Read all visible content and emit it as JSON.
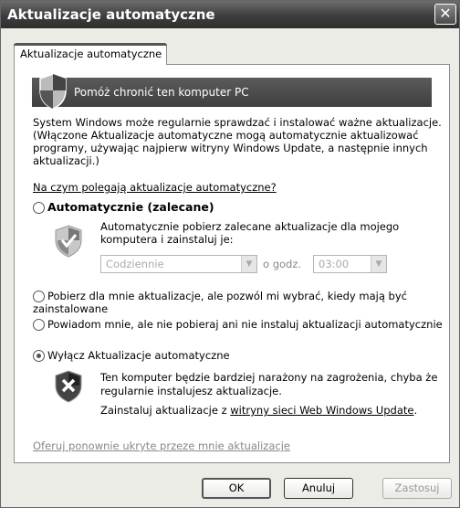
{
  "window": {
    "title": "Aktualizacje automatyczne"
  },
  "tab": {
    "label": "Aktualizacje automatyczne"
  },
  "banner": {
    "text": "Pomóż chronić ten komputer PC"
  },
  "description": "System Windows może regularnie sprawdzać i instalować ważne aktualizacje. (Włączone Aktualizacje automatyczne mogą automatycznie aktualizować programy, używając najpierw witryny Windows Update, a następnie innych aktualizacji.)",
  "how_link": "Na czym polegają aktualizacje automatyczne?",
  "options": {
    "automatic": {
      "label": "Automatycznie (zalecane)",
      "selected": false
    },
    "automatic_desc": "Automatycznie pobierz zalecane aktualizacje dla mojego komputera i zainstaluj je:",
    "frequency": {
      "value": "Codziennie"
    },
    "time_label": "o godz.",
    "time": {
      "value": "03:00"
    },
    "download_only": {
      "label": "Pobierz dla mnie aktualizacje, ale pozwól mi wybrać, kiedy mają być zainstalowane",
      "selected": false
    },
    "notify": {
      "label": "Powiadom mnie, ale nie pobieraj ani nie instaluj aktualizacji automatycznie",
      "selected": false
    },
    "off": {
      "label": "Wyłącz Aktualizacje automatyczne",
      "selected": true
    }
  },
  "warning": {
    "text": "Ten komputer będzie bardziej narażony na zagrożenia, chyba że regularnie instalujesz aktualizacje.",
    "install_prefix": "Zainstaluj aktualizacje z ",
    "install_link": "witryny sieci Web Windows Update",
    "install_suffix": "."
  },
  "hidden_link": "Oferuj ponownie ukryte przeze mnie aktualizacje",
  "buttons": {
    "ok": "OK",
    "cancel": "Anuluj",
    "apply": "Zastosuj"
  }
}
